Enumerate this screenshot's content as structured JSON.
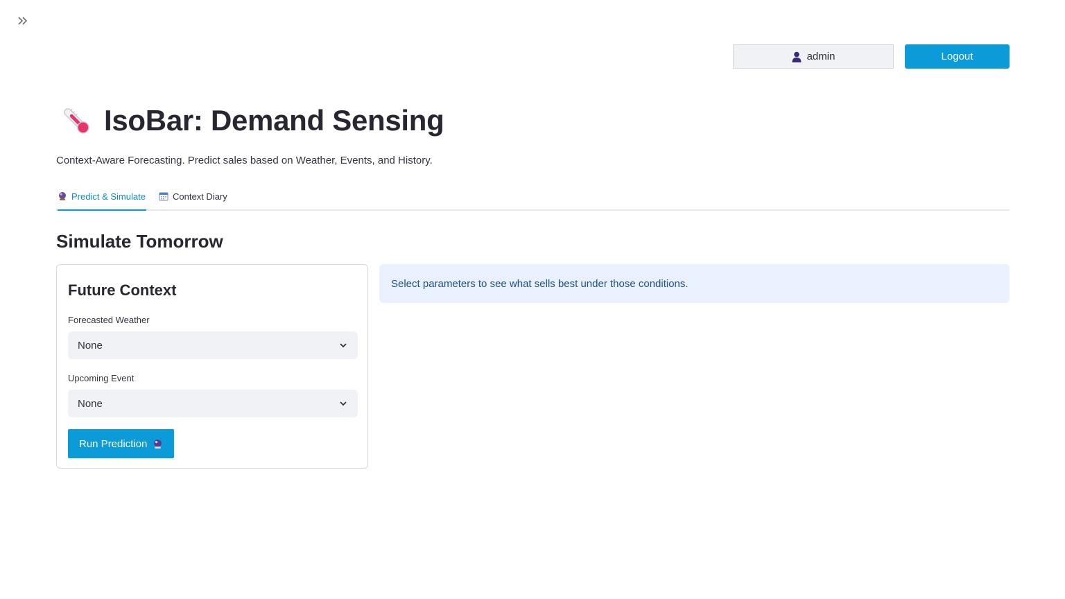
{
  "header": {
    "username": "admin",
    "logout_label": "Logout"
  },
  "app": {
    "title": "IsoBar: Demand Sensing",
    "subtitle": "Context-Aware Forecasting. Predict sales based on Weather, Events, and History."
  },
  "tabs": [
    {
      "label": "Predict & Simulate",
      "icon": "crystal-ball-icon",
      "active": true
    },
    {
      "label": "Context Diary",
      "icon": "calendar-icon",
      "active": false
    }
  ],
  "main": {
    "section_title": "Simulate Tomorrow",
    "form": {
      "title": "Future Context",
      "weather_label": "Forecasted Weather",
      "weather_value": "None",
      "event_label": "Upcoming Event",
      "event_value": "None",
      "run_label": "Run Prediction"
    },
    "info_message": "Select parameters to see what sells best under those conditions."
  },
  "colors": {
    "primary": "#0b9bd9",
    "info_bg": "#e8f1fd",
    "info_text": "#1e4f8a",
    "select_bg": "#f0f2f6"
  }
}
